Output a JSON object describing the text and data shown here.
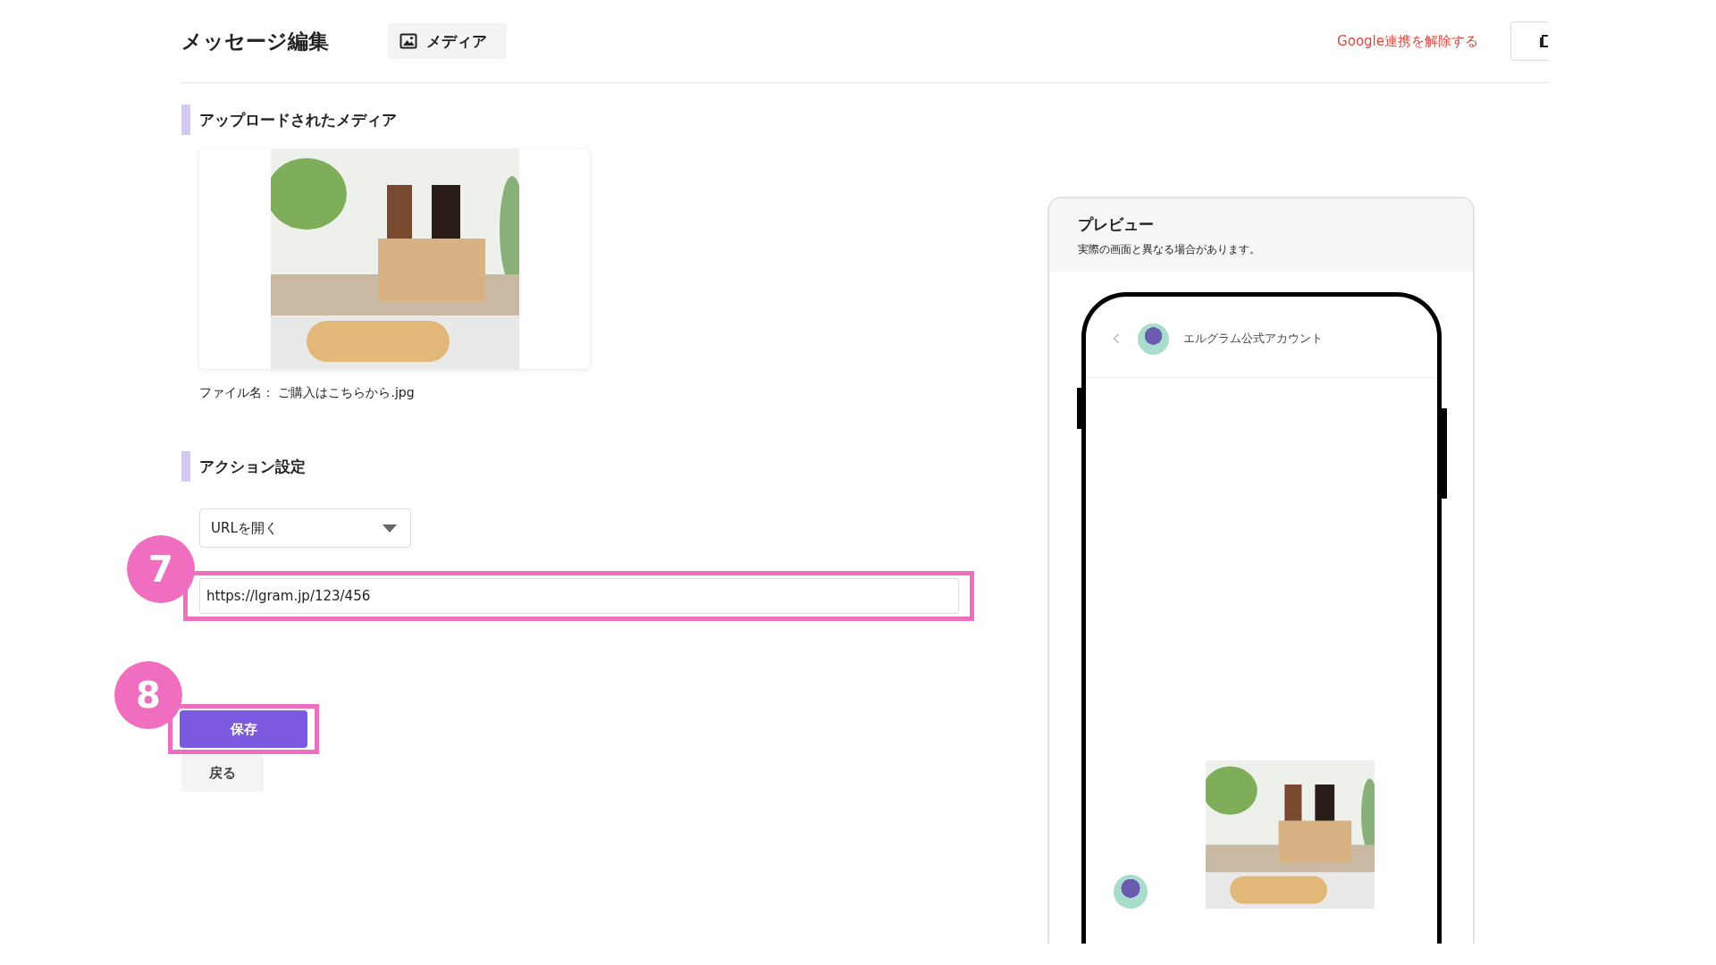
{
  "header": {
    "title": "メッセージ編集",
    "tabs": [
      {
        "label": "メディア",
        "selected": true
      }
    ],
    "unlink_link": "Google連携を解除する"
  },
  "media_section": {
    "heading": "アップロードされたメディア",
    "file_name": "ファイル名： ご購入はこちらから.jpg"
  },
  "action_section": {
    "heading": "アクション設定",
    "action_select": {
      "value": "URLを開く"
    },
    "url_field": {
      "value": "https://lgram.jp/123/456",
      "callout": "7"
    }
  },
  "save_button": {
    "label": "保存",
    "callout": "8"
  },
  "back_button": {
    "label": "戻る"
  },
  "preview": {
    "title": "プレビュー",
    "note": "実際の画面と異なる場合があります。",
    "account_name": "エルグラム公式アカウント"
  }
}
